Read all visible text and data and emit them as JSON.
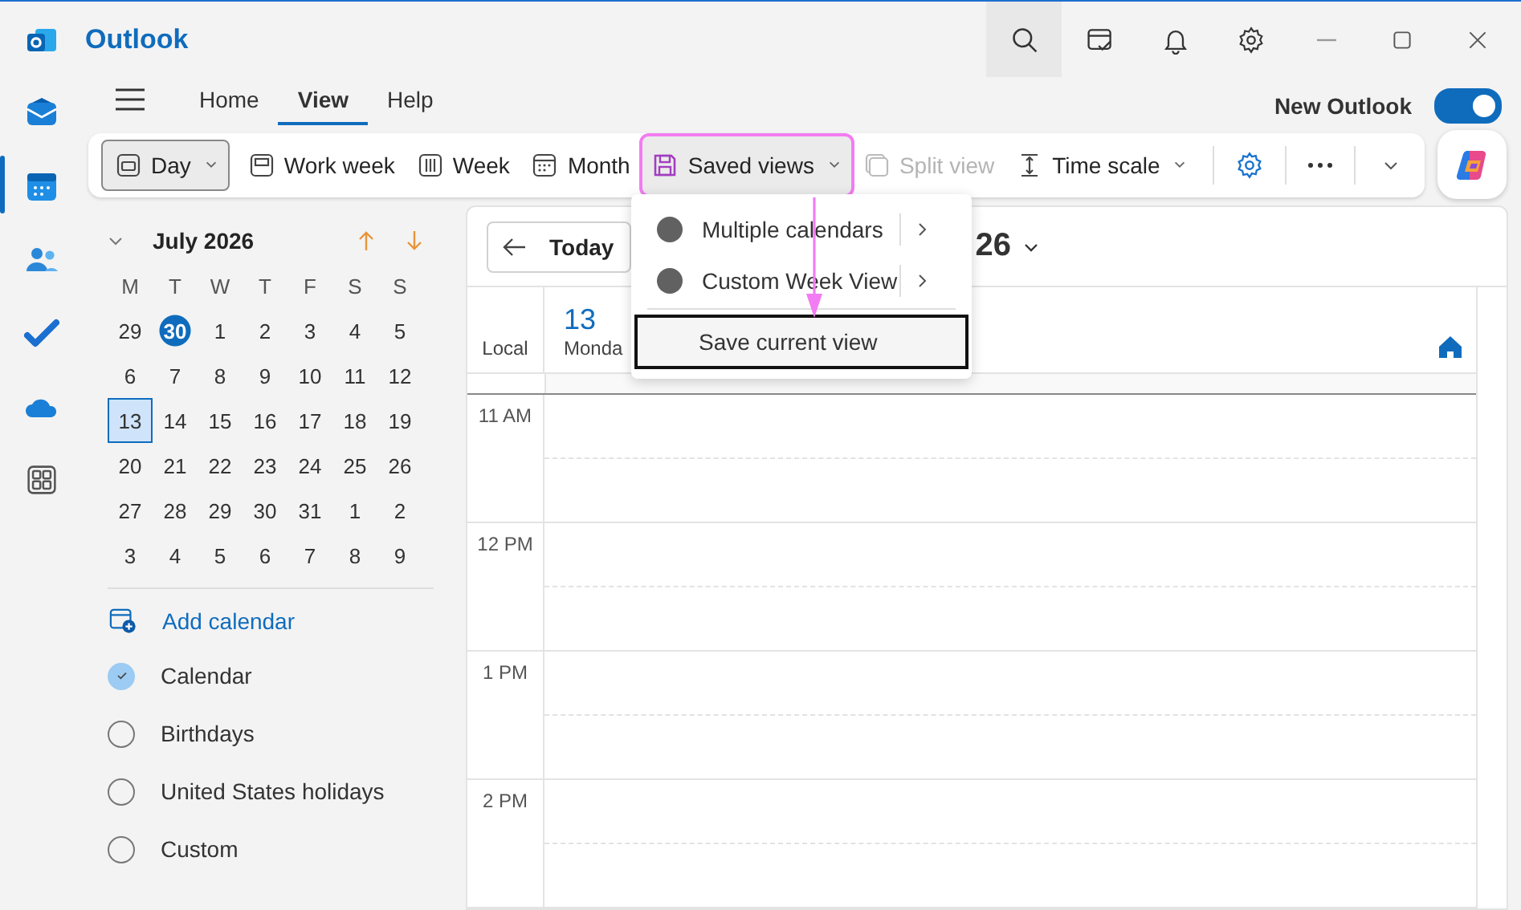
{
  "window": {
    "title": "Outlook"
  },
  "ribbon_tabs": [
    {
      "label": "Home",
      "selected": false
    },
    {
      "label": "View",
      "selected": true
    },
    {
      "label": "Help",
      "selected": false
    }
  ],
  "new_outlook": {
    "label": "New Outlook",
    "on": true
  },
  "toolbar": [
    {
      "label": "Day",
      "selected": true,
      "disabled": false,
      "menu": true,
      "highlighted": false
    },
    {
      "label": "Work week",
      "selected": false,
      "disabled": false,
      "menu": false,
      "highlighted": false
    },
    {
      "label": "Week",
      "selected": false,
      "disabled": false,
      "menu": false,
      "highlighted": false
    },
    {
      "label": "Month",
      "selected": false,
      "disabled": false,
      "menu": false,
      "highlighted": false
    },
    {
      "label": "Saved views",
      "selected": false,
      "disabled": false,
      "menu": true,
      "highlighted": true
    },
    {
      "label": "Split view",
      "selected": false,
      "disabled": true,
      "menu": false,
      "highlighted": false
    },
    {
      "label": "Time scale",
      "selected": false,
      "disabled": false,
      "menu": true,
      "highlighted": false
    }
  ],
  "saved_views_menu": [
    {
      "label": "Multiple calendars",
      "kind": "submenu",
      "selected": false
    },
    {
      "label": "Custom Week View",
      "kind": "submenu",
      "selected": false
    },
    {
      "label": "Save current view",
      "kind": "action",
      "selected": true
    }
  ],
  "mini_calendar": {
    "month": "July 2026",
    "weekdays": [
      "M",
      "T",
      "W",
      "T",
      "F",
      "S",
      "S"
    ],
    "weeks": [
      [
        {
          "d": "29",
          "today": false,
          "selected": false
        },
        {
          "d": "30",
          "today": true,
          "selected": false
        },
        {
          "d": "1",
          "today": false,
          "selected": false
        },
        {
          "d": "2",
          "today": false,
          "selected": false
        },
        {
          "d": "3",
          "today": false,
          "selected": false
        },
        {
          "d": "4",
          "today": false,
          "selected": false
        },
        {
          "d": "5",
          "today": false,
          "selected": false
        }
      ],
      [
        {
          "d": "6",
          "today": false,
          "selected": false
        },
        {
          "d": "7",
          "today": false,
          "selected": false
        },
        {
          "d": "8",
          "today": false,
          "selected": false
        },
        {
          "d": "9",
          "today": false,
          "selected": false
        },
        {
          "d": "10",
          "today": false,
          "selected": false
        },
        {
          "d": "11",
          "today": false,
          "selected": false
        },
        {
          "d": "12",
          "today": false,
          "selected": false
        }
      ],
      [
        {
          "d": "13",
          "today": false,
          "selected": true
        },
        {
          "d": "14",
          "today": false,
          "selected": false
        },
        {
          "d": "15",
          "today": false,
          "selected": false
        },
        {
          "d": "16",
          "today": false,
          "selected": false
        },
        {
          "d": "17",
          "today": false,
          "selected": false
        },
        {
          "d": "18",
          "today": false,
          "selected": false
        },
        {
          "d": "19",
          "today": false,
          "selected": false
        }
      ],
      [
        {
          "d": "20",
          "today": false,
          "selected": false
        },
        {
          "d": "21",
          "today": false,
          "selected": false
        },
        {
          "d": "22",
          "today": false,
          "selected": false
        },
        {
          "d": "23",
          "today": false,
          "selected": false
        },
        {
          "d": "24",
          "today": false,
          "selected": false
        },
        {
          "d": "25",
          "today": false,
          "selected": false
        },
        {
          "d": "26",
          "today": false,
          "selected": false
        }
      ],
      [
        {
          "d": "27",
          "today": false,
          "selected": false
        },
        {
          "d": "28",
          "today": false,
          "selected": false
        },
        {
          "d": "29",
          "today": false,
          "selected": false
        },
        {
          "d": "30",
          "today": false,
          "selected": false
        },
        {
          "d": "31",
          "today": false,
          "selected": false
        },
        {
          "d": "1",
          "today": false,
          "selected": false
        },
        {
          "d": "2",
          "today": false,
          "selected": false
        }
      ],
      [
        {
          "d": "3",
          "today": false,
          "selected": false
        },
        {
          "d": "4",
          "today": false,
          "selected": false
        },
        {
          "d": "5",
          "today": false,
          "selected": false
        },
        {
          "d": "6",
          "today": false,
          "selected": false
        },
        {
          "d": "7",
          "today": false,
          "selected": false
        },
        {
          "d": "8",
          "today": false,
          "selected": false
        },
        {
          "d": "9",
          "today": false,
          "selected": false
        }
      ]
    ]
  },
  "add_calendar": "Add calendar",
  "calendars": [
    {
      "name": "Calendar",
      "checked": true
    },
    {
      "name": "Birthdays",
      "checked": false
    },
    {
      "name": "United States holidays",
      "checked": false
    },
    {
      "name": "Custom",
      "checked": false
    }
  ],
  "calendar_view": {
    "today_button": "Today",
    "date_title": "26",
    "time_zone": "Local",
    "day_number": "13",
    "weekday": "Monda",
    "hours": [
      "11 AM",
      "12 PM",
      "1 PM",
      "2 PM"
    ]
  }
}
